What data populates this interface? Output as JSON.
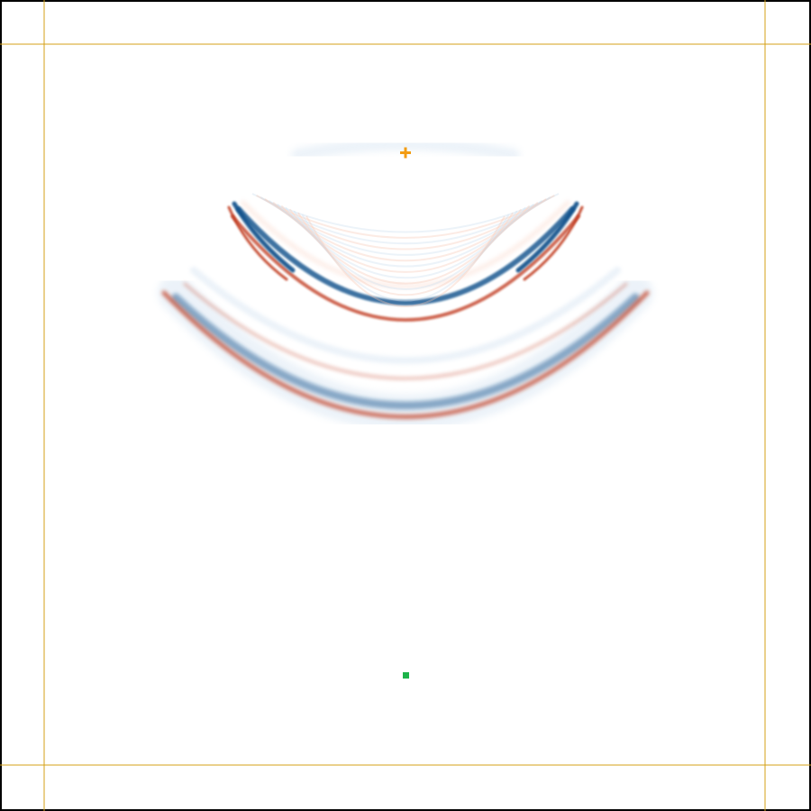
{
  "simulation": {
    "view": "wavefield-snapshot",
    "colormap": "diverging-red-blue",
    "colors": {
      "frame": "#000000",
      "pml_boundary": "#d4a017",
      "source_marker": "#f39c12",
      "receiver_marker": "#1db34a",
      "positive": "#c0391b",
      "negative": "#0b4f8a",
      "positive_soft": "#f7c6b2",
      "negative_soft": "#c9dcee"
    },
    "markers": {
      "source": {
        "shape": "plus",
        "icon": "plus-icon"
      },
      "receiver": {
        "shape": "square",
        "icon": "square-icon"
      }
    }
  }
}
